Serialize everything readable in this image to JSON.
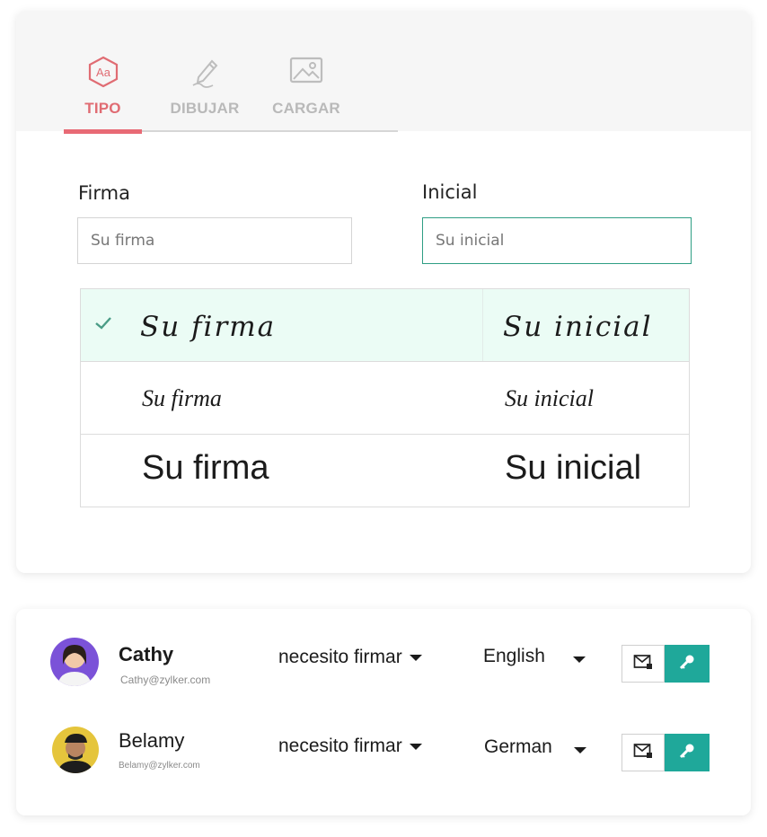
{
  "tabs": [
    {
      "label": "TIPO",
      "icon": "font-type-icon",
      "active": true
    },
    {
      "label": "DIBUJAR",
      "icon": "pencil-draw-icon",
      "active": false
    },
    {
      "label": "CARGAR",
      "icon": "image-upload-icon",
      "active": false
    }
  ],
  "form": {
    "signature_label": "Firma",
    "signature_placeholder": "Su firma",
    "initial_label": "Inicial",
    "initial_placeholder": "Su inicial"
  },
  "styles": [
    {
      "signature": "Su firma",
      "initial": "Su inicial",
      "selected": true
    },
    {
      "signature": "Su firma",
      "initial": "Su inicial",
      "selected": false
    },
    {
      "signature": "Su firma",
      "initial": "Su inicial",
      "selected": false
    }
  ],
  "recipients": [
    {
      "name": "Cathy",
      "email": "Cathy@zylker.com",
      "action": "necesito firmar",
      "language": "English"
    },
    {
      "name": "Belamy",
      "email": "Belamy@zylker.com",
      "action": "necesito firmar",
      "language": "German"
    }
  ],
  "colors": {
    "accent": "#e86a75",
    "teal": "#1fa89a",
    "selected_row": "#ebfcf5"
  }
}
